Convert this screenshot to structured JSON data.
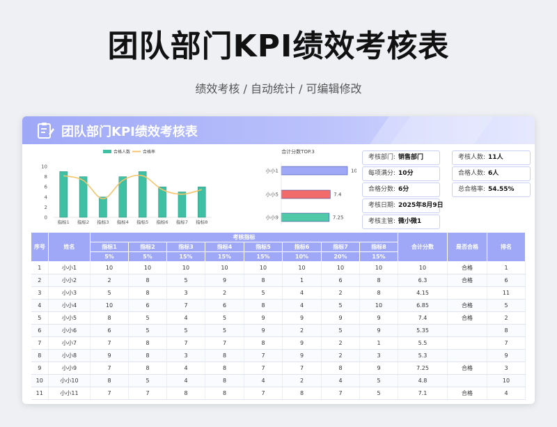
{
  "title": "团队部门KPI绩效考核表",
  "subtitle": "绩效考核 / 自动统计 / 可编辑修改",
  "banner_title": "团队部门KPI绩效考核表",
  "info_left": [
    {
      "label": "考核部门:",
      "value": "销售部门"
    },
    {
      "label": "每项满分:",
      "value": "10分"
    },
    {
      "label": "合格分数:",
      "value": "6分"
    },
    {
      "label": "考核日期:",
      "value": "2025年8月9日"
    },
    {
      "label": "考核主管:",
      "value": "微小微1"
    }
  ],
  "info_right": [
    {
      "label": "考核人数:",
      "value": "11人"
    },
    {
      "label": "合格人数:",
      "value": "6人"
    },
    {
      "label": "总合格率:",
      "value": "54.55%"
    }
  ],
  "table": {
    "h_seq": "序号",
    "h_name": "姓名",
    "h_group": "考核指标",
    "h_total": "合计分数",
    "h_pass": "是否合格",
    "h_rank": "排名",
    "indicators": [
      "指标1",
      "指标2",
      "指标3",
      "指标4",
      "指标5",
      "指标6",
      "指标7",
      "指标8"
    ],
    "weights": [
      "5%",
      "5%",
      "15%",
      "15%",
      "15%",
      "10%",
      "20%",
      "15%"
    ],
    "rows": [
      [
        "1",
        "小小1",
        "10",
        "10",
        "10",
        "10",
        "10",
        "10",
        "10",
        "10",
        "10",
        "合格",
        "1"
      ],
      [
        "2",
        "小小2",
        "2",
        "8",
        "5",
        "9",
        "8",
        "1",
        "6",
        "8",
        "6.3",
        "合格",
        "6"
      ],
      [
        "3",
        "小小3",
        "5",
        "8",
        "3",
        "2",
        "5",
        "4",
        "2",
        "8",
        "4.15",
        "",
        "11"
      ],
      [
        "4",
        "小小4",
        "10",
        "6",
        "7",
        "6",
        "8",
        "4",
        "5",
        "10",
        "6.85",
        "合格",
        "5"
      ],
      [
        "5",
        "小小5",
        "8",
        "5",
        "4",
        "5",
        "9",
        "9",
        "9",
        "9",
        "7.4",
        "合格",
        "2"
      ],
      [
        "6",
        "小小6",
        "6",
        "5",
        "5",
        "5",
        "9",
        "2",
        "5",
        "9",
        "5.35",
        "",
        "8"
      ],
      [
        "7",
        "小小7",
        "7",
        "8",
        "7",
        "7",
        "8",
        "9",
        "2",
        "1",
        "5.5",
        "",
        "7"
      ],
      [
        "8",
        "小小8",
        "9",
        "8",
        "3",
        "8",
        "7",
        "9",
        "2",
        "3",
        "5.3",
        "",
        "9"
      ],
      [
        "9",
        "小小9",
        "7",
        "8",
        "4",
        "8",
        "7",
        "7",
        "8",
        "9",
        "7.25",
        "合格",
        "3"
      ],
      [
        "10",
        "小小10",
        "8",
        "5",
        "4",
        "8",
        "4",
        "2",
        "4",
        "5",
        "4.8",
        "",
        "10"
      ],
      [
        "11",
        "小小11",
        "7",
        "7",
        "8",
        "8",
        "7",
        "8",
        "7",
        "5",
        "7.1",
        "合格",
        "4"
      ]
    ]
  },
  "chart_data": [
    {
      "type": "bar",
      "title": "",
      "categories": [
        "指标1",
        "指标2",
        "指标3",
        "指标4",
        "指标5",
        "指标6",
        "指标7",
        "指标8"
      ],
      "series": [
        {
          "name": "合格人数",
          "type": "bar",
          "values": [
            9,
            8,
            4,
            8,
            9,
            6,
            5,
            6
          ],
          "color": "#3fbfa3"
        },
        {
          "name": "合格率",
          "type": "line",
          "values": [
            0.818,
            0.727,
            0.364,
            0.727,
            0.818,
            0.545,
            0.455,
            0.545
          ],
          "color": "#f5c36b"
        }
      ],
      "y_ticks": [
        "0",
        "2",
        "4",
        "6",
        "8",
        "10"
      ],
      "y2_ticks": [
        "0.00%",
        "20.00%",
        "40.00%",
        "60.00%",
        "80.00%",
        "100.00%"
      ],
      "ylim": [
        0,
        10
      ],
      "y2lim": [
        0,
        1
      ],
      "legend": "top"
    },
    {
      "type": "bar",
      "orientation": "horizontal",
      "title": "合计分数TOP.3",
      "categories": [
        "小小1",
        "小小5",
        "小小9"
      ],
      "values": [
        10,
        7.4,
        7.25
      ],
      "value_labels": [
        "10",
        "7.4",
        "7.25"
      ],
      "colors": [
        "#9ea8f7",
        "#f26b6b",
        "#4fc9a8"
      ],
      "xlim": [
        0,
        10
      ]
    }
  ],
  "colors": {
    "accent": "#9ea8f7",
    "bar": "#3fbfa3",
    "line": "#f5c36b"
  }
}
